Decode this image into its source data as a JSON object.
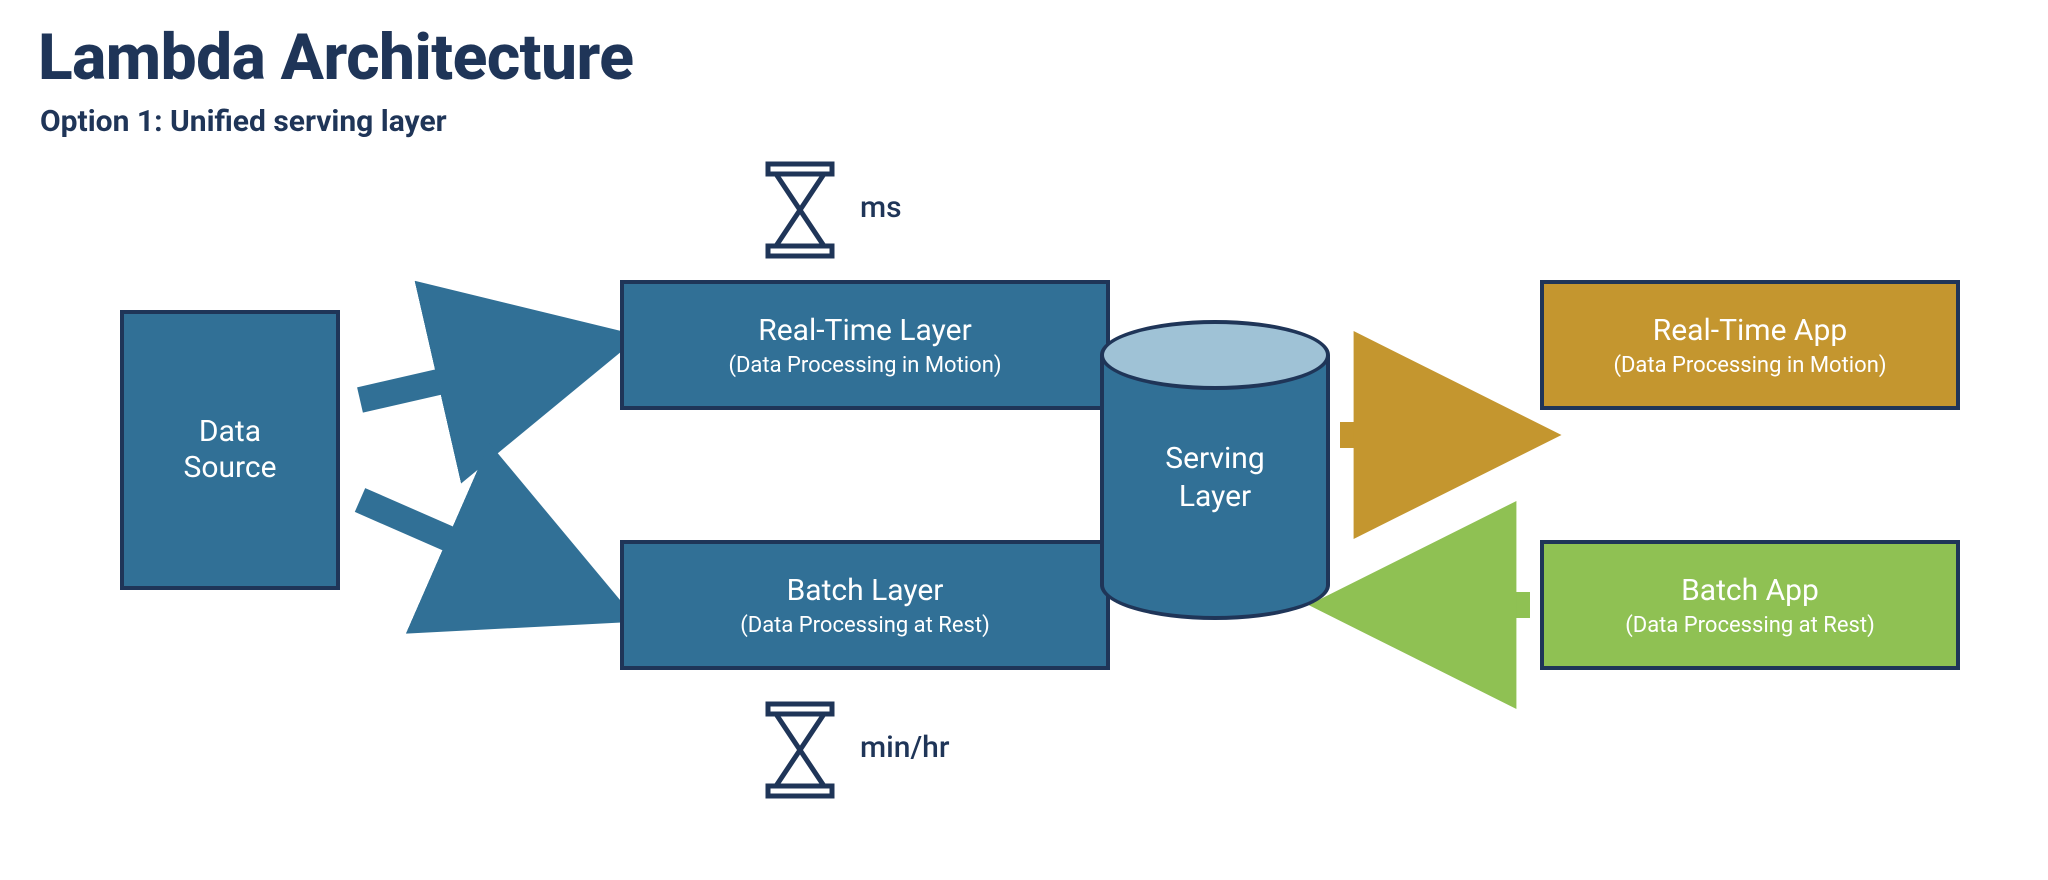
{
  "title": "Lambda Architecture",
  "subtitle": "Option 1: Unified serving layer",
  "timing_top": "ms",
  "timing_bottom": "min/hr",
  "nodes": {
    "data_source": {
      "label": "Data\nSource"
    },
    "realtime_layer": {
      "label": "Real-Time Layer",
      "sub": "(Data Processing in Motion)"
    },
    "batch_layer": {
      "label": "Batch Layer",
      "sub": "(Data Processing at Rest)"
    },
    "serving_layer": {
      "label": "Serving\nLayer"
    },
    "realtime_app": {
      "label": "Real-Time App",
      "sub": "(Data Processing in Motion)"
    },
    "batch_app": {
      "label": "Batch App",
      "sub": "(Data Processing at Rest)"
    }
  },
  "colors": {
    "blue_fill": "#317096",
    "blue_border": "#1f3558",
    "gold": "#c4962f",
    "green": "#8fc153",
    "cyl_top": "#9fc2d6"
  }
}
